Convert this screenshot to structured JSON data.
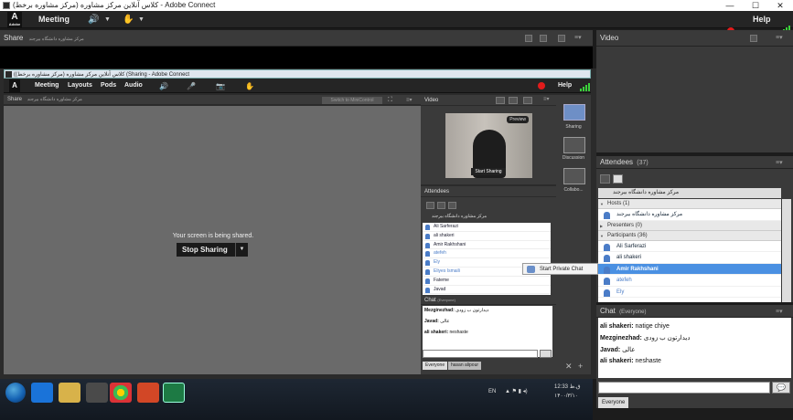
{
  "window": {
    "title": "(کلاس آنلاین مرکز مشاوره (مرکز مشاوره برخط - Adobe Connect",
    "minimize": "—",
    "maximize": "☐",
    "close": "✕"
  },
  "menubar": {
    "logo": "A",
    "logo_sub": "Adobe",
    "meeting": "Meeting",
    "help": "Help"
  },
  "share_pod": {
    "title": "Share",
    "subtitle": "مرکز مشاوره دانشگاه بیرجند"
  },
  "video_pod": {
    "title": "Video"
  },
  "inner_window": {
    "title": "(کلاس آنلاین مرکز مشاوره (مرکز مشاوره برخط) (Sharing - Adobe Connect",
    "menu": {
      "meeting": "Meeting",
      "layouts": "Layouts",
      "pods": "Pods",
      "audio": "Audio",
      "help": "Help"
    },
    "share_title": "Share",
    "share_subtitle": "مرکز مشاوره دانشگاه بیرجند",
    "switch_mini": "Switch to MiniControl",
    "shared_message": "Your screen is being shared.",
    "stop_sharing": "Stop Sharing",
    "stop_dd": "▼",
    "video_title": "Video",
    "preview": "Preview",
    "start_sharing": "Start Sharing",
    "attendees_title": "Attendees",
    "attendees_sub": "مرکز مشاوره دانشگاه بیرجند",
    "attendees": [
      "Ali Sarferazi",
      "ali shakeri",
      "Amir Rakhshani",
      "atefeh",
      "Ely",
      "Eliyes Ismaili",
      "Fateme",
      "Javad"
    ],
    "chat_title": "Chat",
    "chat_scope": "(Everyone)",
    "chat_messages": [
      {
        "user": "Mezginezhad:",
        "text": "دیدارتون ب زودی"
      },
      {
        "user": "Javad:",
        "text": "عالی"
      },
      {
        "user": "ali shakeri:",
        "text": "neshaste"
      }
    ],
    "chat_tabs": [
      "Everyone",
      "hasan alipour"
    ],
    "layouts": [
      "Sharing",
      "Discussion",
      "Collabo..."
    ]
  },
  "attendees_pod": {
    "title": "Attendees",
    "count": "(37)",
    "room_name": "مرکز مشاوره دانشگاه بیرجند",
    "hosts_label": "Hosts (1)",
    "host_name": "مرکز مشاوره دانشگاه بیرجند",
    "presenters_label": "Presenters (0)",
    "participants_label": "Participants (36)",
    "participants": [
      "Ali Sarferazi",
      "ali shakeri",
      "Amir Rakhshani",
      "atefeh",
      "Ely"
    ],
    "selected": "Amir Rakhshani"
  },
  "tooltip": {
    "label": "Start Private Chat"
  },
  "chat_pod": {
    "title": "Chat",
    "scope": "(Everyone)",
    "messages": [
      {
        "user": "ali shakeri:",
        "text": "natige chiye"
      },
      {
        "user": "Mezginezhad:",
        "text": "دیدارتون ب زودی"
      },
      {
        "user": "Javad:",
        "text": "عالی"
      },
      {
        "user": "ali shakeri:",
        "text": "neshaste"
      }
    ],
    "tab": "Everyone",
    "send_icon": "💬"
  },
  "taskbar": {
    "lang": "EN",
    "time": "12:33 ق.ظ",
    "date": "۱۴۰۰/۳/۱۰"
  },
  "colors": {
    "accent": "#4a90e2",
    "signal": "#3bd13b",
    "record": "#e21b1b"
  }
}
